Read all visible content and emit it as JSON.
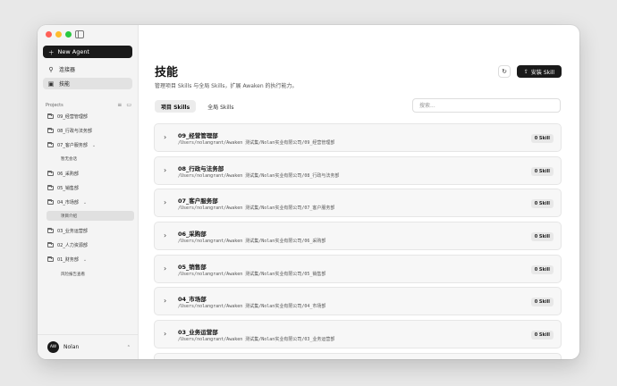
{
  "sidebar": {
    "new_agent_label": "New Agent",
    "nav": [
      {
        "label": "连接器",
        "icon": "plug-icon"
      },
      {
        "label": "技能",
        "icon": "briefcase-icon"
      }
    ],
    "projects_title": "Projects",
    "projects": [
      {
        "label": "09_经营管理部"
      },
      {
        "label": "08_行政与法务部"
      },
      {
        "label": "07_客户服务部",
        "expanded": true,
        "children": [
          "暂无会话"
        ]
      },
      {
        "label": "06_采购部"
      },
      {
        "label": "05_销售部"
      },
      {
        "label": "04_市场部",
        "expanded": true,
        "children": [
          "项目介绍"
        ]
      },
      {
        "label": "03_业务运营部"
      },
      {
        "label": "02_人力资源部"
      },
      {
        "label": "01_财务部",
        "expanded": true,
        "children": [
          "风险报告查看"
        ]
      }
    ],
    "user": {
      "initials": "AW",
      "name": "Nolan"
    }
  },
  "main": {
    "title": "技能",
    "subtitle": "管理项目 Skills 与全局 Skills，扩展 Awaken 的执行能力。",
    "install_label": "安装 Skill",
    "tabs": [
      {
        "label": "项目 Skills",
        "active": true
      },
      {
        "label": "全局 Skills",
        "active": false
      }
    ],
    "search_placeholder": "搜索...",
    "rows": [
      {
        "name": "09_经营管理部",
        "path": "/Users/nolangrant/Awaken 测试集/Nolan实业有限公司/09_经营管理部",
        "badge": "0 Skill"
      },
      {
        "name": "08_行政与法务部",
        "path": "/Users/nolangrant/Awaken 测试集/Nolan实业有限公司/08_行政与法务部",
        "badge": "0 Skill"
      },
      {
        "name": "07_客户服务部",
        "path": "/Users/nolangrant/Awaken 测试集/Nolan实业有限公司/07_客户服务部",
        "badge": "0 Skill"
      },
      {
        "name": "06_采购部",
        "path": "/Users/nolangrant/Awaken 测试集/Nolan实业有限公司/06_采购部",
        "badge": "0 Skill"
      },
      {
        "name": "05_销售部",
        "path": "/Users/nolangrant/Awaken 测试集/Nolan实业有限公司/05_销售部",
        "badge": "0 Skill"
      },
      {
        "name": "04_市场部",
        "path": "/Users/nolangrant/Awaken 测试集/Nolan实业有限公司/04_市场部",
        "badge": "0 Skill"
      },
      {
        "name": "03_业务运营部",
        "path": "/Users/nolangrant/Awaken 测试集/Nolan实业有限公司/03_业务运营部",
        "badge": "0 Skill"
      }
    ]
  }
}
